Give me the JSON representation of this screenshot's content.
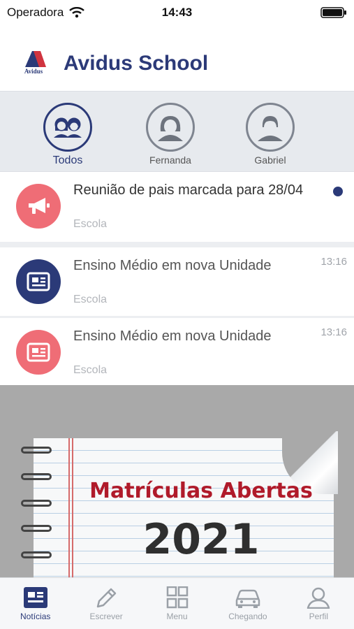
{
  "status_bar": {
    "carrier": "Operadora",
    "time": "14:43"
  },
  "header": {
    "title": "Avidus School",
    "logo_text": "Avidus"
  },
  "filters": [
    {
      "label": "Todos",
      "active": true
    },
    {
      "label": "Fernanda",
      "active": false
    },
    {
      "label": "Gabriel",
      "active": false
    }
  ],
  "feed": [
    {
      "title": "Reunião de pais marcada para 28/04",
      "source": "Escola",
      "time": "",
      "unread": true,
      "icon": "megaphone-icon",
      "icon_color": "#ef6d76"
    },
    {
      "title": "Ensino Médio em nova Unidade",
      "source": "Escola",
      "time": "13:16",
      "unread": false,
      "icon": "newspaper-icon",
      "icon_color": "#2b3a78"
    },
    {
      "title": "Ensino Médio em nova Unidade",
      "source": "Escola",
      "time": "13:16",
      "unread": false,
      "icon": "newspaper-icon",
      "icon_color": "#ef6d76"
    }
  ],
  "banner": {
    "title": "Matrículas Abertas",
    "year": "2021"
  },
  "tabbar": {
    "items": [
      {
        "label": "Notícias",
        "icon": "news-icon",
        "active": true
      },
      {
        "label": "Escrever",
        "icon": "pencil-icon",
        "active": false
      },
      {
        "label": "Menu",
        "icon": "grid-icon",
        "active": false
      },
      {
        "label": "Chegando",
        "icon": "car-icon",
        "active": false
      },
      {
        "label": "Perfil",
        "icon": "person-icon",
        "active": false
      }
    ]
  },
  "colors": {
    "brand": "#2b3a78",
    "accent_red": "#ef6d76"
  }
}
